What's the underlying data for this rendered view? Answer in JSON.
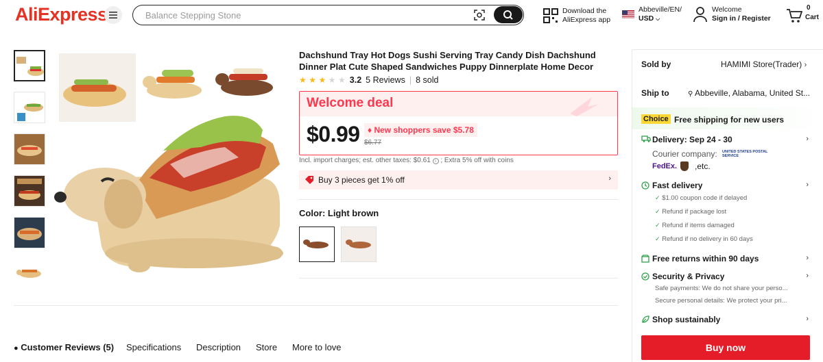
{
  "header": {
    "logo": "AliExpress",
    "search_placeholder": "Balance Stepping Stone",
    "download_line1": "Download the",
    "download_line2": "AliExpress app",
    "region_line1": "Abbeville/EN/",
    "region_line2": "USD",
    "welcome_line1": "Welcome",
    "welcome_line2": "Sign in / Register",
    "cart_count": "0",
    "cart_label": "Cart"
  },
  "product": {
    "title": "Dachshund Tray Hot Dogs Sushi Serving Tray Candy Dish Dachshund Dinner Plat Cute Shaped Sandwiches Puppy Dinnerplate Home Decor",
    "rating": "3.2",
    "stars_filled": 3,
    "reviews": "5 Reviews",
    "sold": "8 sold",
    "deal_title": "Welcome deal",
    "price": "$0.99",
    "save_text": "New shoppers save $5.78",
    "original_price": "$6.77",
    "tax_text": "Incl. import charges; est. other taxes: $0.61",
    "tax_extra": "; Extra 5% off with coins",
    "promo_text": "Buy 3 pieces get 1% off",
    "color_label": "Color: Light brown"
  },
  "tabs": [
    {
      "label": "Customer Reviews (5)"
    },
    {
      "label": "Specifications"
    },
    {
      "label": "Description"
    },
    {
      "label": "Store"
    },
    {
      "label": "More to love"
    }
  ],
  "panel": {
    "sold_by_label": "Sold by",
    "sold_by_value": "HAMIMI Store(Trader)",
    "ship_to_label": "Ship to",
    "ship_to_value": "Abbeville, Alabama, United St...",
    "choice_badge": "Choice",
    "choice_text": "Free shipping for new users",
    "delivery": "Delivery: Sep 24 - 30",
    "courier_label": "Courier company:",
    "courier_usps": "UNITED STATES POSTAL SERVICE",
    "courier_fedex": "FedEx.",
    "courier_etc": ",etc.",
    "fast_delivery": "Fast delivery",
    "fast_items": [
      "$1.00 coupon code if delayed",
      "Refund if package lost",
      "Refund if items damaged",
      "Refund if no delivery in 60 days"
    ],
    "free_returns": "Free returns within 90 days",
    "security": "Security & Privacy",
    "security_items": [
      "Safe payments: We do not share your perso...",
      "Secure personal details: We protect your pri..."
    ],
    "sustain": "Shop sustainably",
    "buy_now": "Buy now"
  },
  "colors": {
    "accent_red": "#fd384f",
    "buy_red": "#e51d28",
    "check_green": "#2fa24b",
    "choice_yellow": "#fdd835"
  }
}
